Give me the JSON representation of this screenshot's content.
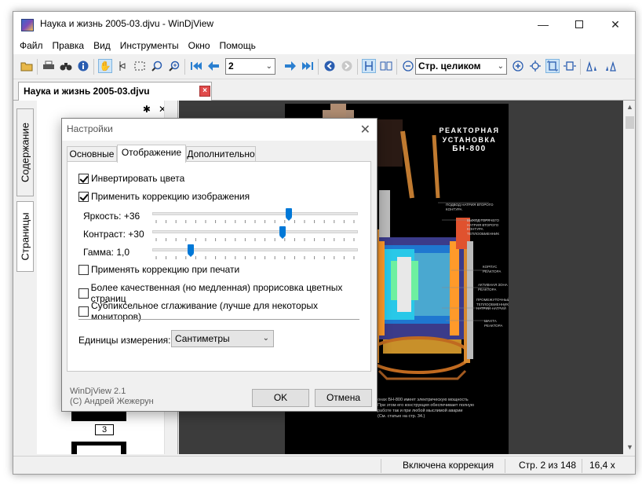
{
  "window": {
    "title": "Наука и жизнь 2005-03.djvu - WinDjView",
    "minimize_icon": "minimize-icon",
    "maximize_icon": "maximize-icon",
    "close_icon": "close-icon"
  },
  "menu": [
    "Файл",
    "Правка",
    "Вид",
    "Инструменты",
    "Окно",
    "Помощь"
  ],
  "toolbar": {
    "page_value": "2",
    "zoom_value": "Стр. целиком"
  },
  "tab": {
    "label": "Наука и жизнь 2005-03.djvu",
    "close": "×"
  },
  "sidebar": {
    "tabs": [
      "Содержание",
      "Страницы"
    ],
    "thumb_page_number": "3"
  },
  "page_content": {
    "title_line1": "РЕАКТОРНАЯ",
    "title_line2": "УСТАНОВКА",
    "title_line3": "БН-800",
    "labels": [
      "ПОДВОД НАТРИЯ ВТОРОГО КОНТУРА",
      "ВЫХОД ГОРЯЧЕГО НАТРИЯ ВТОРОГО КОНТУРА ТЕПЛООБМЕННИК",
      "КОРПУС РЕАКТОРА",
      "АКТИВНАЯ ЗОНА РЕАКТОРА",
      "ПРОМЕЖУТОЧНЫЙ ТЕПЛООБМЕННИК НАТРИЙ-НАТРИЙ",
      "ШАХТА РЕАКТОРА"
    ],
    "caption_line1": "онах БН-800 имеет электрическую мощность",
    "caption_line2": "При этом его конструкция обеспечивает полную",
    "caption_line3": "работе так и при любой мыслимой аварии",
    "caption_line4": "(См. статью на стр. 34.)"
  },
  "status": {
    "correction": "Включена коррекция",
    "page": "Стр. 2 из 148",
    "size": "16,4 x"
  },
  "dialog": {
    "title": "Настройки",
    "tabs": [
      "Основные",
      "Отображение",
      "Дополнительно"
    ],
    "active_tab": 1,
    "invert_colors": {
      "label": "Инвертировать цвета",
      "checked": true
    },
    "apply_correction": {
      "label": "Применить коррекцию изображения",
      "checked": true
    },
    "brightness": {
      "label": "Яркость: +36",
      "value": 36,
      "range": [
        -100,
        100
      ]
    },
    "contrast": {
      "label": "Контраст: +30",
      "value": 30,
      "range": [
        -100,
        100
      ]
    },
    "gamma": {
      "label": "Гамма: 1,0",
      "value": 1.0
    },
    "print_correction": {
      "label": "Применять коррекцию при печати",
      "checked": false
    },
    "hq_color": {
      "label": "Более качественная (но медленная) прорисовка цветных страниц",
      "checked": false
    },
    "subpixel": {
      "label": "Субпиксельное сглаживание (лучше для некоторых мониторов)",
      "checked": false
    },
    "units_label": "Единицы измерения:",
    "units_value": "Сантиметры",
    "footer_line1": "WinDjView 2.1",
    "footer_line2": "(C) Андрей Жежерун",
    "ok": "OK",
    "cancel": "Отмена"
  }
}
